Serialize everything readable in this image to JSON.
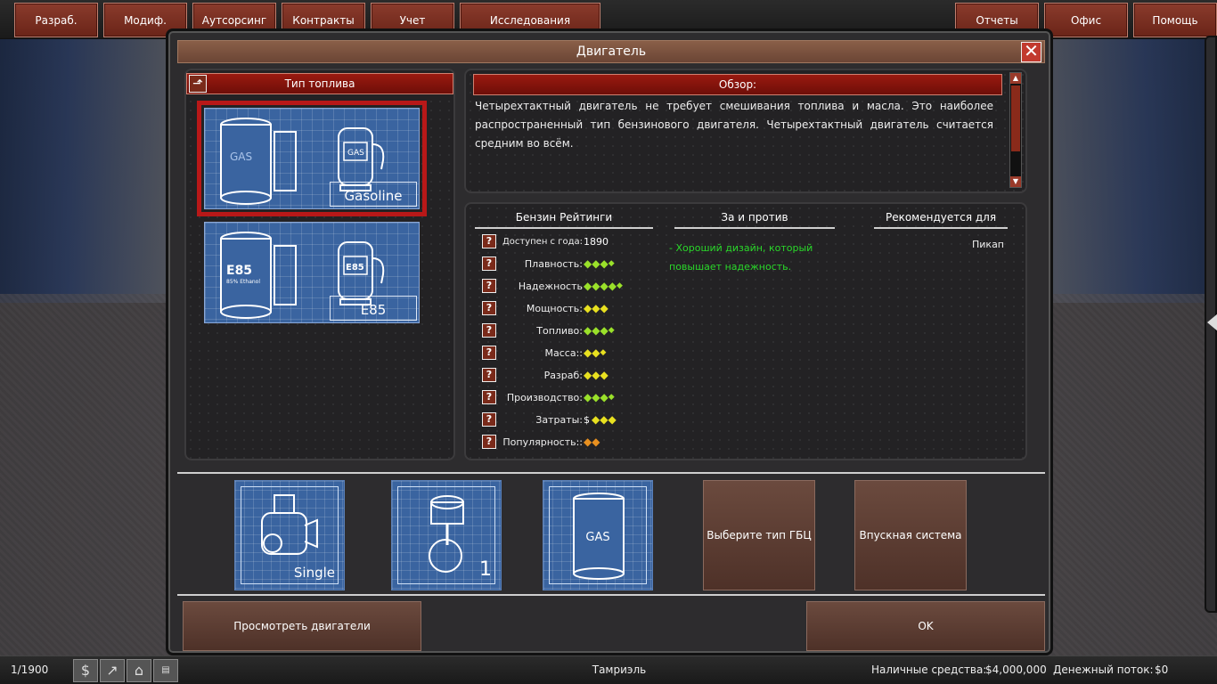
{
  "topbar": {
    "left": [
      "Разраб.",
      "Модиф.",
      "Аутсорсинг",
      "Контракты",
      "Учет",
      "Исследования"
    ],
    "right": [
      "Отчеты",
      "Офис",
      "Помощь"
    ]
  },
  "window": {
    "title": "Двигатель",
    "close_icon": "close-icon"
  },
  "fuel": {
    "header": "Тип топлива",
    "options": [
      {
        "label": "Gasoline",
        "tank_text": "GAS",
        "pump_text": "GAS",
        "selected": true
      },
      {
        "label": "E85",
        "tank_text": "E85",
        "tank_subtext": "85% Ethanol",
        "pump_text": "E85",
        "selected": false
      }
    ]
  },
  "overview": {
    "header": "Обзор:",
    "text": "Четырехтактный двигатель не требует смешивания топлива и масла. Это наиболее распространенный тип бензинового двигателя. Четырехтактный двигатель считается средним во всём."
  },
  "ratings": {
    "header": "Бензин Рейтинги",
    "available_label": "Доступен с года:",
    "available_value": "1890",
    "rows": [
      {
        "label": "Плавность:",
        "stars": 3.5,
        "color": "green"
      },
      {
        "label": "Надежность",
        "stars": 4.5,
        "color": "green"
      },
      {
        "label": "Мощность:",
        "stars": 3,
        "color": "yellow"
      },
      {
        "label": "Топливо:",
        "stars": 3.5,
        "color": "green"
      },
      {
        "label": "Масса::",
        "stars": 2.5,
        "color": "yellow"
      },
      {
        "label": "Разраб:",
        "stars": 3,
        "color": "yellow"
      },
      {
        "label": "Производство:",
        "stars": 3.5,
        "color": "green"
      },
      {
        "label": "Затраты:",
        "prefix": "$",
        "stars": 3,
        "color": "yellow"
      },
      {
        "label": "Популярность::",
        "stars": 2,
        "color": "orange"
      }
    ]
  },
  "pros_cons": {
    "header": "За и против",
    "items": [
      "- Хороший дизайн, который повышает надежность."
    ]
  },
  "recommended": {
    "header": "Рекомендуется для",
    "items": [
      "Пикап"
    ]
  },
  "parts": {
    "layout_label": "Single",
    "cylinders_label": "1",
    "fuel_label": "GAS",
    "head_button": "Выберите тип ГБЦ",
    "intake_button": "Впускная система"
  },
  "actions": {
    "view_engines": "Просмотреть двигатели",
    "ok": "OK"
  },
  "statusbar": {
    "date": "1/1900",
    "location": "Тамриэль",
    "cash_label": "Наличные средства:",
    "cash_value": "$4,000,000",
    "flow_label": "Денежный поток:",
    "flow_value": "$0",
    "icons": [
      "dollar-icon",
      "trend-icon",
      "bank-icon",
      "bill-icon"
    ]
  }
}
